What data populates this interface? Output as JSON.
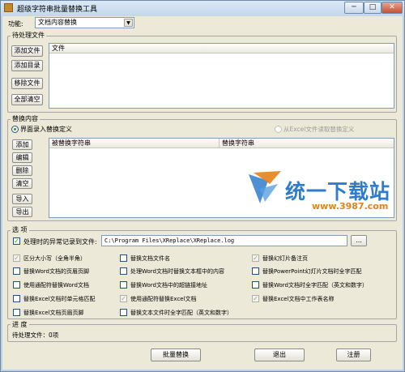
{
  "window": {
    "title": "超级字符串批量替换工具",
    "min_glyph": "─",
    "max_glyph": "□",
    "close_glyph": "✕"
  },
  "function_row": {
    "label": "功能:",
    "selected": "文档内容替换"
  },
  "pending": {
    "group_title": "待处理文件",
    "column_header": "文件",
    "buttons": {
      "add_file": "添加文件",
      "add_dir": "添加目录",
      "remove_file": "移除文件",
      "clear_all": "全部清空"
    }
  },
  "replace": {
    "group_title": "替换内容",
    "radio_ui": "界面录入替换定义",
    "radio_excel": "从Excel文件读取替换定义",
    "col_find": "被替换字符串",
    "col_replace": "替换字符串",
    "buttons": {
      "add": "添加",
      "edit": "编辑",
      "delete": "删除",
      "clear": "清空",
      "import": "导入",
      "export": "导出"
    }
  },
  "options": {
    "group_title": "选 项",
    "log_label": "处理时的异常记录到文件:",
    "log_path": "C:\\Program Files\\XReplace\\XReplace.log",
    "browse": "...",
    "checks": [
      {
        "label": "区分大小写（全角半角）",
        "checked": true,
        "disabled": true
      },
      {
        "label": "替换文档文件名",
        "checked": false,
        "disabled": false
      },
      {
        "label": "替换幻灯片备注页",
        "checked": true,
        "disabled": true
      },
      {
        "label": "替换Word文档的页眉页脚",
        "checked": false,
        "disabled": false
      },
      {
        "label": "处理Word文档时替换文本框中的内容",
        "checked": false,
        "disabled": false
      },
      {
        "label": "替换PowerPoint幻灯片文档时全字匹配",
        "checked": false,
        "disabled": false
      },
      {
        "label": "使用通配符替换Word文档",
        "checked": false,
        "disabled": false
      },
      {
        "label": "替换Word文档中的超链接地址",
        "checked": false,
        "disabled": false
      },
      {
        "label": "替换Word文档时全字匹配（英文和数字）",
        "checked": false,
        "disabled": false
      },
      {
        "label": "替换Excel文档时单元格匹配",
        "checked": false,
        "disabled": false
      },
      {
        "label": "使用通配符替换Excel文档",
        "checked": true,
        "disabled": true
      },
      {
        "label": "替换Excel文档中工作表名称",
        "checked": true,
        "disabled": true
      },
      {
        "label": "替换Excel文档页眉页脚",
        "checked": false,
        "disabled": false
      },
      {
        "label": "替换文本文件时全字匹配（英文和数字）",
        "checked": false,
        "disabled": false
      }
    ]
  },
  "progress": {
    "group_title": "进 度",
    "status": "待处理文件：0项"
  },
  "bottom": {
    "batch": "批量替换",
    "exit": "退出",
    "register": "注册"
  },
  "watermark": {
    "text": "统一下载站",
    "url": "www.3987.com"
  }
}
